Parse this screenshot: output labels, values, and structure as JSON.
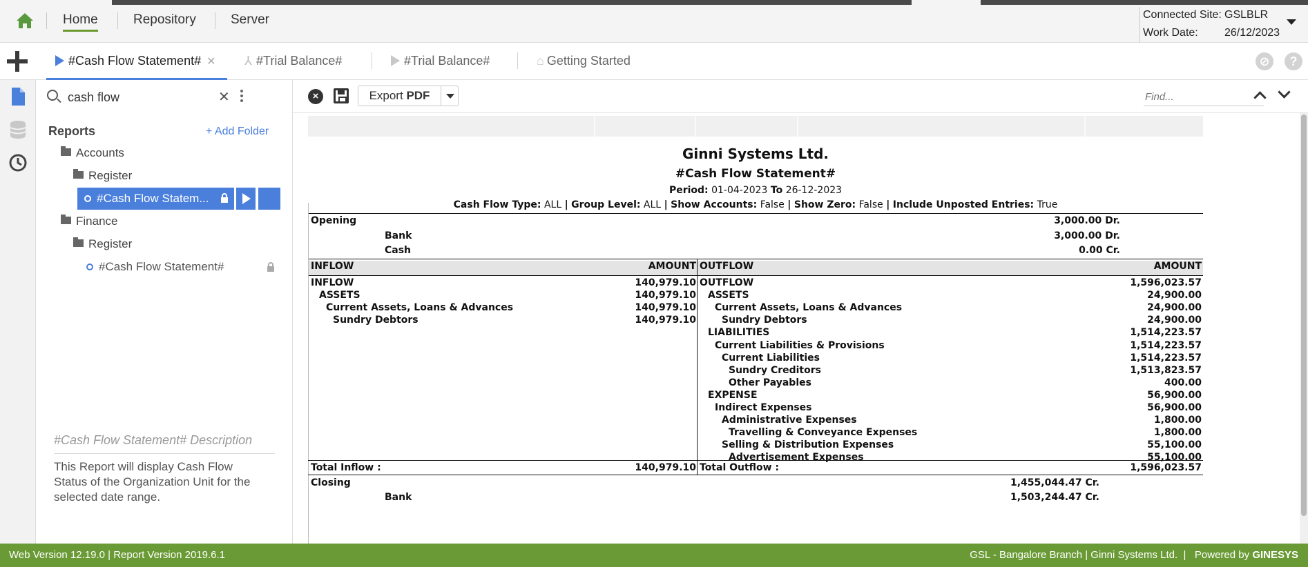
{
  "topnav": {
    "items": [
      "Home",
      "Repository",
      "Server"
    ],
    "active": "Home",
    "connected_site_label": "Connected Site:",
    "connected_site_value": "GSLBLR",
    "work_date_label": "Work Date:",
    "work_date_value": "26/12/2023"
  },
  "tabs": [
    {
      "label": "#Cash Flow Statement#",
      "active": true
    },
    {
      "label": "#Trial Balance#",
      "active": false
    },
    {
      "label": "#Trial Balance#",
      "active": false
    },
    {
      "label": "Getting Started",
      "active": false
    }
  ],
  "sidebar": {
    "search_value": "cash flow",
    "title": "Reports",
    "add_folder": "+ Add Folder",
    "tree": {
      "folder1": "Accounts",
      "subfolder1": "Register",
      "selected_item": "#Cash Flow Statem...",
      "folder2": "Finance",
      "subfolder2": "Register",
      "item2": "#Cash Flow Statement#"
    },
    "description_title": "#Cash Flow Statement# Description",
    "description_text": "This Report will display Cash Flow Status of the Organization Unit for the selected date range."
  },
  "toolbar": {
    "export_label": "Export",
    "export_format": "PDF",
    "find_placeholder": "Find..."
  },
  "report": {
    "company": "Ginni Systems Ltd.",
    "name": "#Cash Flow Statement#",
    "period_label": "Period:",
    "period_from": "01-04-2023",
    "period_to_label": "To",
    "period_to": "26-12-2023",
    "filters": [
      {
        "label": "Cash Flow Type:",
        "value": "ALL"
      },
      {
        "label": "Group Level:",
        "value": "ALL"
      },
      {
        "label": "Show Accounts:",
        "value": "False"
      },
      {
        "label": "Show Zero:",
        "value": "False"
      },
      {
        "label": "Include Unposted Entries:",
        "value": "True"
      }
    ],
    "opening": {
      "label": "Opening",
      "amount": "3,000.00 Dr.",
      "rows": [
        {
          "label": "Bank",
          "amount": "3,000.00 Dr."
        },
        {
          "label": "Cash",
          "amount": "0.00 Cr."
        }
      ]
    },
    "headers": {
      "inflow": "INFLOW",
      "amount1": "AMOUNT",
      "outflow": "OUTFLOW",
      "amount2": "AMOUNT"
    },
    "inflow_rows": [
      {
        "label": "INFLOW",
        "amount": "140,979.10",
        "level": 0
      },
      {
        "label": "ASSETS",
        "amount": "140,979.10",
        "level": 1
      },
      {
        "label": "Current Assets, Loans & Advances",
        "amount": "140,979.10",
        "level": 2
      },
      {
        "label": "Sundry Debtors",
        "amount": "140,979.10",
        "level": 3
      }
    ],
    "outflow_rows": [
      {
        "label": "OUTFLOW",
        "amount": "1,596,023.57",
        "level": 0
      },
      {
        "label": "ASSETS",
        "amount": "24,900.00",
        "level": 1
      },
      {
        "label": "Current Assets, Loans & Advances",
        "amount": "24,900.00",
        "level": 2
      },
      {
        "label": "Sundry Debtors",
        "amount": "24,900.00",
        "level": 3
      },
      {
        "label": "LIABILITIES",
        "amount": "1,514,223.57",
        "level": 1
      },
      {
        "label": "Current Liabilities & Provisions",
        "amount": "1,514,223.57",
        "level": 2
      },
      {
        "label": "Current Liabilities",
        "amount": "1,514,223.57",
        "level": 3
      },
      {
        "label": "Sundry Creditors",
        "amount": "1,513,823.57",
        "level": 4
      },
      {
        "label": "Other Payables",
        "amount": "400.00",
        "level": 4
      },
      {
        "label": "EXPENSE",
        "amount": "56,900.00",
        "level": 1
      },
      {
        "label": "Indirect Expenses",
        "amount": "56,900.00",
        "level": 2
      },
      {
        "label": "Administrative Expenses",
        "amount": "1,800.00",
        "level": 3
      },
      {
        "label": "Travelling & Conveyance Expenses",
        "amount": "1,800.00",
        "level": 4
      },
      {
        "label": "Selling & Distribution Expenses",
        "amount": "55,100.00",
        "level": 3
      },
      {
        "label": "Advertisement Expenses",
        "amount": "55,100.00",
        "level": 4
      }
    ],
    "total_inflow_label": "Total Inflow :",
    "total_inflow": "140,979.10",
    "total_outflow_label": "Total Outflow :",
    "total_outflow": "1,596,023.57",
    "closing": {
      "label": "Closing",
      "amount": "1,455,044.47 Cr.",
      "rows": [
        {
          "label": "Bank",
          "amount": "1,503,244.47 Cr."
        }
      ]
    }
  },
  "statusbar": {
    "left": "Web Version 12.19.0 | Report Version 2019.6.1",
    "right_prefix": "GSL - Bangalore Branch | Ginni Systems Ltd.  |   Powered by ",
    "brand": "GINESYS"
  },
  "colors": {
    "accent_blue": "#4a7fdc",
    "brand_green": "#6a9a35",
    "nav_underline": "#6a9a2e"
  }
}
